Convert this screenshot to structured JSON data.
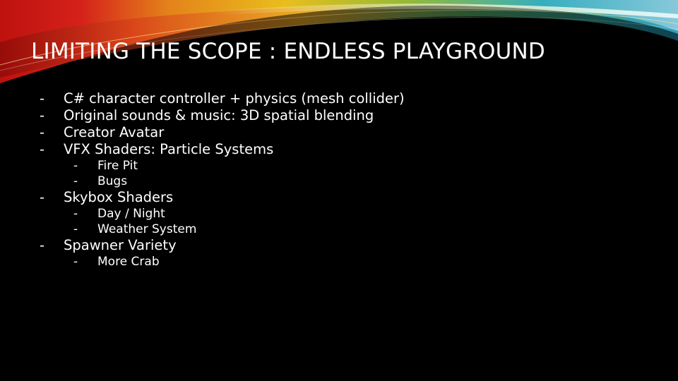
{
  "slide": {
    "title": "LIMITING THE SCOPE : ENDLESS PLAYGROUND",
    "bullet_marker": "-",
    "bullets": [
      {
        "level": 1,
        "text": "C# character controller + physics (mesh collider)"
      },
      {
        "level": 1,
        "text": "Original sounds & music: 3D spatial blending"
      },
      {
        "level": 1,
        "text": "Creator Avatar"
      },
      {
        "level": 1,
        "text": "VFX Shaders: Particle Systems"
      },
      {
        "level": 2,
        "text": "Fire Pit"
      },
      {
        "level": 2,
        "text": "Bugs"
      },
      {
        "level": 1,
        "text": "Skybox Shaders"
      },
      {
        "level": 2,
        "text": "Day / Night"
      },
      {
        "level": 2,
        "text": "Weather System"
      },
      {
        "level": 1,
        "text": "Spawner Variety"
      },
      {
        "level": 2,
        "text": "More Crab"
      }
    ]
  },
  "theme": {
    "background": "#000000",
    "text": "#ffffff",
    "swoosh_colors": [
      "#e0241b",
      "#f08a1c",
      "#f5c81e",
      "#9cc43a",
      "#39b7c9",
      "#8fd3e6"
    ]
  }
}
